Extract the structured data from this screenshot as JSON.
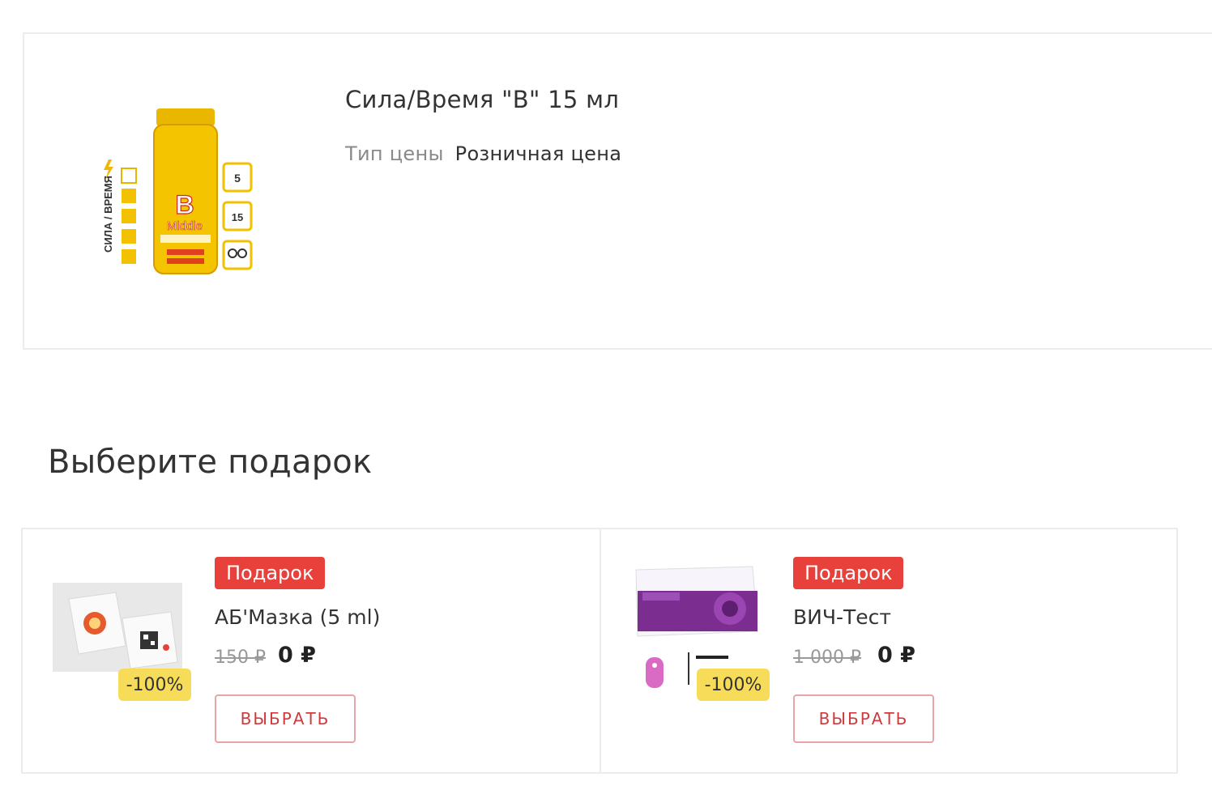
{
  "product": {
    "title": "Сила/Время \"В\" 15 мл",
    "price_type_label": "Тип цены",
    "price_type_value": "Розничная цена",
    "image_icon": "bottle-image"
  },
  "gifts_section": {
    "title": "Выберите подарок"
  },
  "gifts": [
    {
      "tag": "Подарок",
      "name": "АБ'Мазка (5 ml)",
      "old_price": "150 ₽",
      "new_price": "0 ₽",
      "discount": "-100%",
      "button_label": "ВЫБРАТЬ"
    },
    {
      "tag": "Подарок",
      "name": "ВИЧ-Тест",
      "old_price": "1 000 ₽",
      "new_price": "0 ₽",
      "discount": "-100%",
      "button_label": "ВЫБРАТЬ"
    }
  ],
  "colors": {
    "tag_bg": "#e8413c",
    "badge_bg": "#f7dc5a",
    "button_border": "#e7a5a7",
    "button_text": "#d0393d"
  }
}
